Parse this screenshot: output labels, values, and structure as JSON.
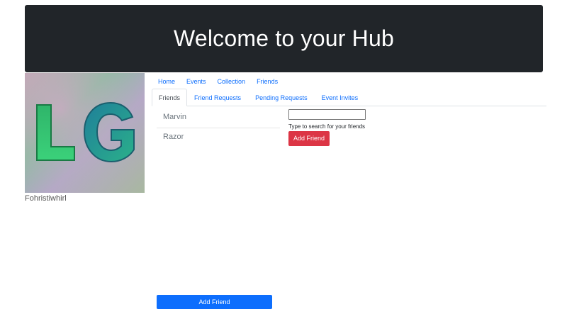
{
  "header": {
    "title": "Welcome to your Hub"
  },
  "profile": {
    "username": "Fohristiwhirl",
    "picture_letters": "LG"
  },
  "nav": {
    "items": [
      {
        "label": "Home"
      },
      {
        "label": "Events"
      },
      {
        "label": "Collection"
      },
      {
        "label": "Friends"
      }
    ]
  },
  "tabs": [
    {
      "label": "Friends",
      "active": true
    },
    {
      "label": "Friend Requests",
      "active": false
    },
    {
      "label": "Pending Requests",
      "active": false
    },
    {
      "label": "Event Invites",
      "active": false
    }
  ],
  "friends": [
    {
      "name": "Marvin"
    },
    {
      "name": "Razor"
    }
  ],
  "search": {
    "value": "",
    "hint": "Type to search for your friends",
    "button_label": "Add Friend"
  },
  "bottom_button": {
    "label": "Add Friend"
  },
  "colors": {
    "banner": "#212529",
    "link": "#0d6efd",
    "danger": "#dc3545",
    "primary": "#0d6efd"
  }
}
